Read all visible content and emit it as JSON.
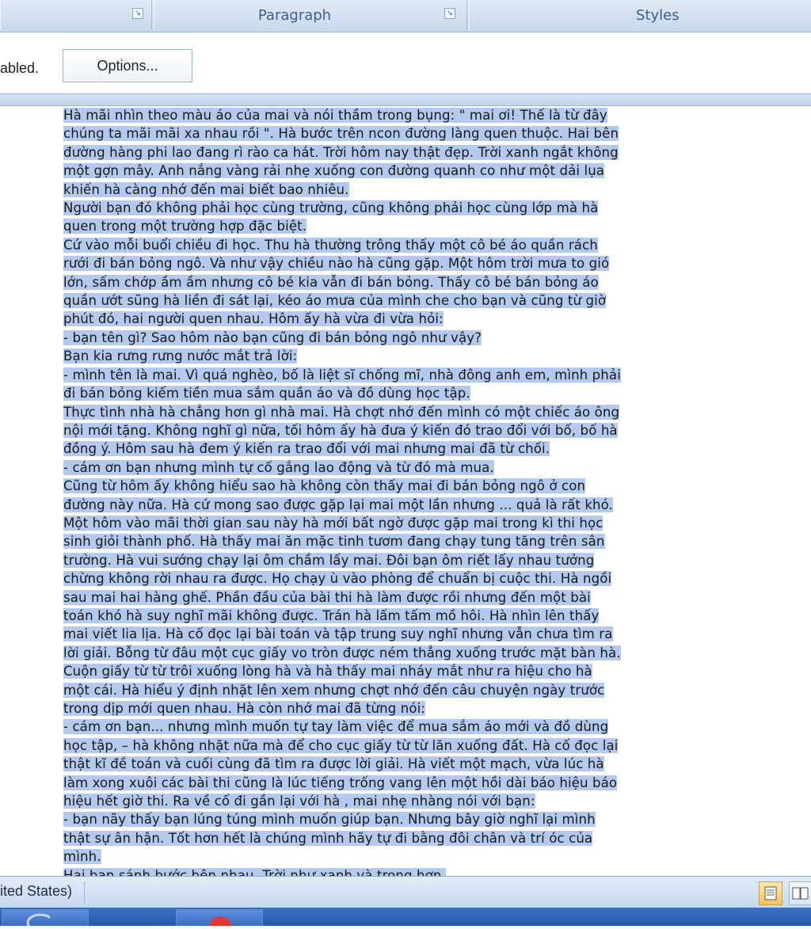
{
  "ribbon": {
    "groups": [
      {
        "label": ""
      },
      {
        "label": "Paragraph"
      },
      {
        "label": "Styles"
      }
    ]
  },
  "message_bar": {
    "text": "abled.",
    "options_button": "Options..."
  },
  "document": {
    "lines": [
      "Hà mãi nhìn theo màu áo của mai và nói thầm trong bụng: \" mai ơi! Thế là từ đây",
      "chúng ta mãi mãi xa nhau rồi \". Hà bước trên ncon đường làng quen thuộc. Hai bên",
      "đường hàng phi lao đang rì rào ca hát. Trời hôm nay thật đẹp. Trời xanh ngắt không",
      "một gợn mây. Anh nắng vàng rải nhẹ xuống con đường quanh co như một dải lụa",
      "khiến hà càng nhớ đến mai biết bao nhiêu.",
      "Người bạn đó không phải học cùng trường, cũng không phải học cùng lớp mà hà",
      "quen trong một trường hợp đặc biệt.",
      "Cứ vào mỗi buổi chiều đi học. Thu hà thường trông thấy một cô bé áo quần rách",
      "rưới đi bán bỏng ngô. Và như vậy chiều nào hà cũng gặp. Một hôm trời mưa to gió",
      "lớn, sấm chớp ầm ầm nhưng cô bé kia vẫn đi bán bỏng. Thấy cô bé bán bỏng áo",
      "quần ướt sũng hà liền đi sát lại, kéo áo mưa của mình che cho bạn và cũng từ giờ",
      "phút đó, hai người quen nhau. Hôm ấy hà vừa đi vừa hỏi:",
      "- bạn tên gì? Sao hôm nào bạn cũng đi bán bỏng ngô như vậy?",
      "Bạn kia rưng rưng nước mắt trả lời:",
      "- mình tên là mai. Vì quá nghèo, bố là liệt sĩ chống mĩ, nhà đông anh em, mình phải",
      "đi bán bỏng kiếm tiền mua sắm quần áo và đồ dùng học tập.",
      "Thực tình nhà hà chẳng hơn gì nhà mai. Hà chợt nhớ đến mình có một chiếc áo ông",
      "nội mới tặng. Không nghĩ gì nữa, tối hôm ấy hà đưa ý kiến đó trao đổi với bố, bố hà",
      "đồng ý. Hôm sau hà đem ý kiến ra trao đổi với mai nhưng mai đã từ chối.",
      "- cám ơn bạn nhưng mình tự cố gắng lao động và từ đó mà mua.",
      "Cũng từ hôm ấy không hiểu sao hà không còn thấy mai đi bán bỏng ngô ở con",
      "đường này nữa. Hà cứ mong sao được gặp lại mai một lần nhưng ... quả là rất khó.",
      "Một hôm vào mãi thời gian sau này hà mới bất ngờ được gặp mai trong kì thi học",
      "sinh giỏi thành phố. Hà thấy mai ăn mặc tinh tươm đang chạy tung tăng trên sân",
      "trường. Hà vui sướng chạy lại ôm chầm lấy mai. Đôi bạn ôm riết lấy nhau tưởng",
      "chừng không rời nhau ra được. Họ chạy ù vào phòng để chuẩn bị cuộc thi. Hà ngồi",
      "sau mai hai hàng ghế. Phần đầu của bài thi hà làm được rồi nhưng đến một bài",
      "toán khó hà suy nghĩ mãi không được. Trán hà lấm tấm mồ hôi. Hà nhìn lên thấy",
      "mai viết lia lịa. Hà cố đọc lại bài toán và tập trung suy nghĩ nhưng vẫn chưa tìm ra",
      "lời giải. Bỗng từ đâu một cục giấy vo tròn được ném thẳng xuống trước mặt bàn hà.",
      "Cuộn giấy từ từ trôi xuống lòng hà và hà thấy mai nháy mắt như ra hiệu cho hà",
      "một cái. Hà hiểu ý định nhặt lên xem nhưng chợt nhớ đến câu chuyện ngày trước",
      "trong dịp mới quen nhau. Hà còn nhớ mai đã từng nói:",
      "- cám ơn bạn... nhưng mình muốn tự tay làm việc để mua sắm áo mới và đồ dùng",
      "học tập, – hà không nhặt nữa mà để cho cục giấy từ từ lăn xuống đất. Hà cố đọc lại",
      "thật kĩ đề toán và cuối cùng đã tìm ra được lời giải. Hà viết một mạch, vừa lúc hà",
      "làm xong xuôi các bài thi cũng là lúc tiếng trống vang lên một hồi dài báo hiệu báo",
      "hiệu hết giờ thi. Ra về cố đi gần lại với hà , mai nhẹ nhàng nói với bạn:",
      "- bạn nãy thấy bạn lúng túng mình muốn giúp bạn. Nhưng bây giờ nghĩ lại mình",
      "thật sự ân hận. Tốt hơn hết là chúng mình hãy tự đi bằng đôi chân và trí óc của",
      "mình.",
      "Hai bạn sánh bước bên nhau. Trời như xanh và trong hơn."
    ]
  },
  "status_bar": {
    "language": "ited States)"
  },
  "colors": {
    "selection": "#b3c9ee",
    "ribbon_text": "#3e5f8a",
    "taskbar": "#245aa8"
  }
}
